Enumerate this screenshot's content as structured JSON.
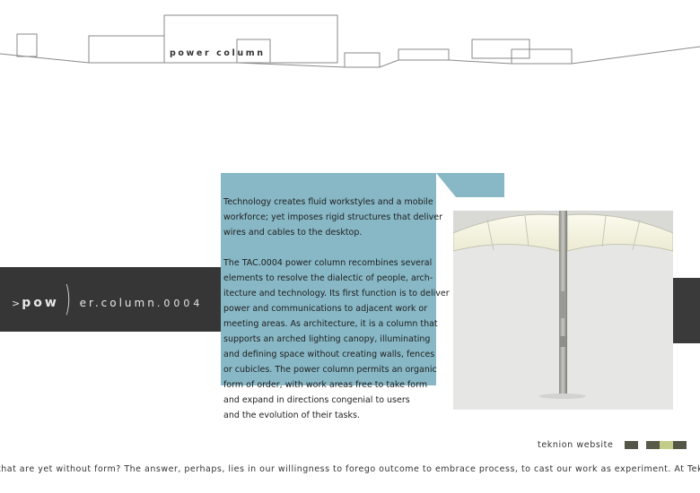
{
  "header": {
    "title": "power column"
  },
  "logo": {
    "part_a": ">",
    "part_b": "pow",
    "paren": ")",
    "part_c": "er.column",
    "part_d": ".0004"
  },
  "body": {
    "paragraph_1": "Technology creates fluid workstyles and a mobile\nworkforce; yet imposes rigid structures that deliver\nwires and cables to the desktop.",
    "paragraph_2": "The TAC.0004 power column recombines several\nelements to resolve the dialectic of people, arch-\nitecture and technology. Its first function is to deliver\npower and communications to adjacent work or\nmeeting areas. As architecture, it is a column that\nsupports an arched lighting canopy, illuminating\nand defining space without creating walls, fences\nor cubicles. The power column permits an organic\nform of order, with work areas free to take form\nand expand in directions congenial to users\nand the evolution of their tasks."
  },
  "footer": {
    "teknion_link": "teknion website",
    "swatches": [
      "#545647",
      "#585b4a",
      "#c4cc8a",
      "#545647"
    ],
    "ticker": "that are yet without form? The answer, perhaps, lies in our willingness to forego outcome to embrace process, to cast our work as experiment. At Teknion, we"
  },
  "colors": {
    "panel_blue": "#88b8c6",
    "band_dark": "#363636"
  },
  "icons": {
    "skyline": "skyline-outline-graphic",
    "product": "power-column-photo"
  }
}
